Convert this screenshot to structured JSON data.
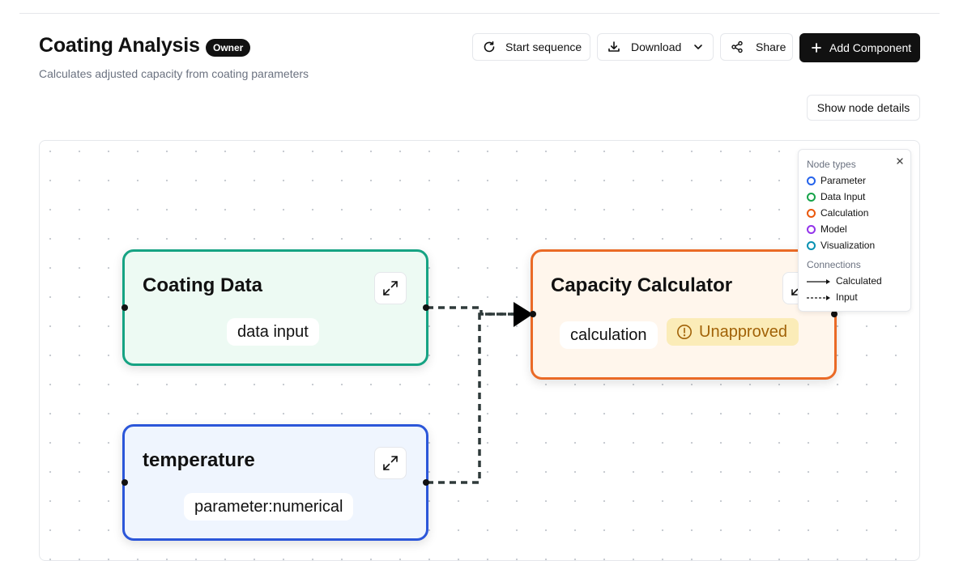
{
  "header": {
    "title": "Coating Analysis",
    "badge": "Owner",
    "subtitle": "Calculates adjusted capacity from coating parameters"
  },
  "toolbar": {
    "start_label": "Start sequence",
    "download_label": "Download",
    "share_label": "Share",
    "add_label": "Add Component",
    "details_label": "Show node details"
  },
  "nodes": {
    "coating": {
      "title": "Coating Data",
      "chip": "data input"
    },
    "capacity": {
      "title": "Capacity Calculator",
      "chip": "calculation",
      "status": "Unapproved"
    },
    "temperature": {
      "title": "temperature",
      "chip": "parameter:numerical"
    }
  },
  "legend": {
    "node_types_heading": "Node types",
    "types": [
      {
        "label": "Parameter",
        "color": "#2563eb"
      },
      {
        "label": "Data Input",
        "color": "#16a34a"
      },
      {
        "label": "Calculation",
        "color": "#ea580c"
      },
      {
        "label": "Model",
        "color": "#9333ea"
      },
      {
        "label": "Visualization",
        "color": "#0891b2"
      }
    ],
    "connections_heading": "Connections",
    "calculated_label": "Calculated",
    "input_label": "Input"
  },
  "colors": {
    "data_input_border": "#16a383",
    "data_input_bg": "#edfaf3",
    "calculation_border": "#ea6a26",
    "calculation_bg": "#fff6ec",
    "parameter_border": "#2b56d9",
    "parameter_bg": "#eff5fe",
    "warning_bg": "#fbecb8",
    "warning_text": "#a16207"
  }
}
